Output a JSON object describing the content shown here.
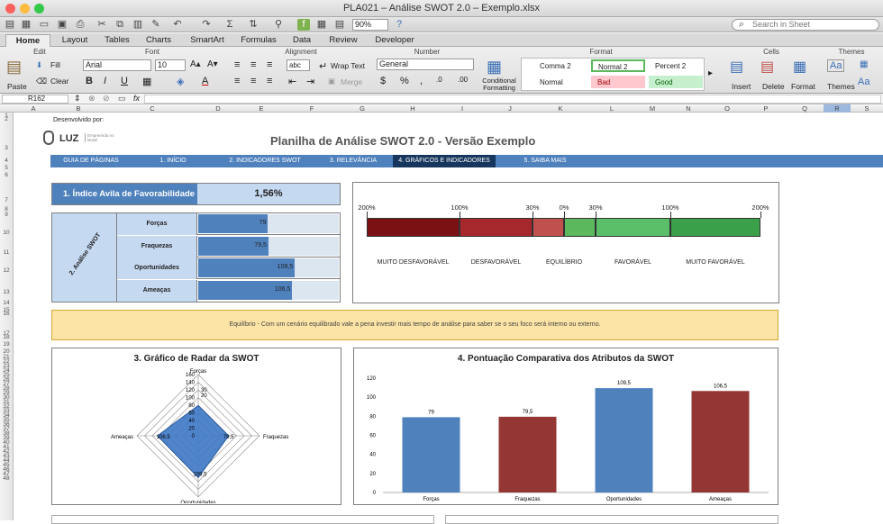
{
  "window": {
    "title": "PLA021 – Análise SWOT 2.0 – Exemplo.xlsx",
    "zoom": "90%",
    "search_placeholder": "Search in Sheet"
  },
  "ribbon_tabs": [
    "Home",
    "Layout",
    "Tables",
    "Charts",
    "SmartArt",
    "Formulas",
    "Data",
    "Review",
    "Developer"
  ],
  "ribbon": {
    "groups": [
      "Edit",
      "Font",
      "Alignment",
      "Number",
      "Format",
      "Cells",
      "Themes"
    ],
    "paste": "Paste",
    "fill": "Fill",
    "clear": "Clear",
    "font_name": "Arial",
    "font_size": "10",
    "wrap": "Wrap Text",
    "merge": "Merge",
    "abc": "abc",
    "number_format": "General",
    "cond_fmt": "Conditional Formatting",
    "styles": [
      "Comma 2",
      "Normal 2",
      "Percent 2",
      "Normal",
      "Bad",
      "Good"
    ],
    "insert": "Insert",
    "delete": "Delete",
    "format": "Format",
    "themes": "Themes",
    "aa": "Aa"
  },
  "formula": {
    "cell": "R162",
    "fx": "fx"
  },
  "columns": [
    "A",
    "B",
    "C",
    "D",
    "E",
    "F",
    "G",
    "H",
    "I",
    "J",
    "K",
    "L",
    "M",
    "N",
    "O",
    "P",
    "Q",
    "R",
    "S"
  ],
  "rows": [
    "1",
    "2",
    "3",
    "4",
    "5",
    "6",
    "7",
    "8",
    "9",
    "10",
    "11",
    "12",
    "13",
    "14",
    "15",
    "16",
    "17",
    "18",
    "19",
    "20",
    "21",
    "22",
    "23",
    "24",
    "25",
    "26",
    "27",
    "28",
    "29",
    "30",
    "31",
    "32",
    "33",
    "34",
    "35",
    "36",
    "37",
    "38",
    "39",
    "40",
    "41",
    "42",
    "43",
    "44",
    "45",
    "46",
    "47",
    "48"
  ],
  "header": {
    "dev": "Desenvolvido por:",
    "logo": "LUZ",
    "logo_sub": "Empreenda no Brasil",
    "title": "Planilha de Análise SWOT 2.0 - Versão Exemplo"
  },
  "nav": [
    "GUIA DE PÁGINAS",
    "1. INÍCIO",
    "2. INDICADORES SWOT",
    "3. RELEVÂNCIA",
    "4. GRÁFICOS E INDICADORES",
    "5. SAIBA MAIS"
  ],
  "index": {
    "label": "1. Índice Avila de Favorabilidade",
    "value": "1,56%"
  },
  "swot": {
    "side_label": "2. Análise SWOT",
    "items": [
      {
        "name": "Forças",
        "value": "79",
        "v": 79
      },
      {
        "name": "Fraquezas",
        "value": "79,5",
        "v": 79.5
      },
      {
        "name": "Oportunidades",
        "value": "109,5",
        "v": 109.5
      },
      {
        "name": "Ameaças",
        "value": "106,5",
        "v": 106.5
      }
    ]
  },
  "scale": {
    "ticks": [
      "200%",
      "100%",
      "30%",
      "0%",
      "30%",
      "100%",
      "200%"
    ],
    "labels": [
      "MUITO DESFAVORÁVEL",
      "DESFAVORÁVEL",
      "EQUILÍBRIO",
      "FAVORÁVEL",
      "MUITO FAVORÁVEL"
    ],
    "colors": [
      "#7b1113",
      "#a7282c",
      "#c0504d",
      "#5cb85c",
      "#5bbf6a",
      "#3aa04a"
    ]
  },
  "message": "Equilíbrio - Com um cenário equilibrado vale a pena investir mais tempo de análise para saber se o seu foco será interno ou externo.",
  "radar": {
    "title": "3. Gráfico de Radar da SWOT",
    "axes": [
      "Forças",
      "Fraquezas",
      "Oportunidades",
      "Ameaças"
    ],
    "values": [
      79,
      79.5,
      109.5,
      106.5
    ],
    "value_labels": [
      "79",
      "79,5",
      "109,5",
      "106,5"
    ],
    "ticks": [
      "160",
      "140",
      "120",
      "100",
      "80",
      "60",
      "40",
      "20",
      "0"
    ],
    "ticks2": [
      "30",
      "20"
    ]
  },
  "chart_data": {
    "type": "bar",
    "title": "4. Pontuação Comparativa dos Atributos da SWOT",
    "categories": [
      "Forças",
      "Fraquezas",
      "Oportunidades",
      "Ameaças"
    ],
    "values": [
      79,
      79.5,
      109.5,
      106.5
    ],
    "value_labels": [
      "79",
      "79,5",
      "109,5",
      "106,5"
    ],
    "colors": [
      "#4f81bd",
      "#943634",
      "#4f81bd",
      "#943634"
    ],
    "ylim": [
      0,
      120
    ],
    "yticks": [
      "120",
      "100",
      "80",
      "60",
      "40",
      "20",
      "0"
    ]
  }
}
